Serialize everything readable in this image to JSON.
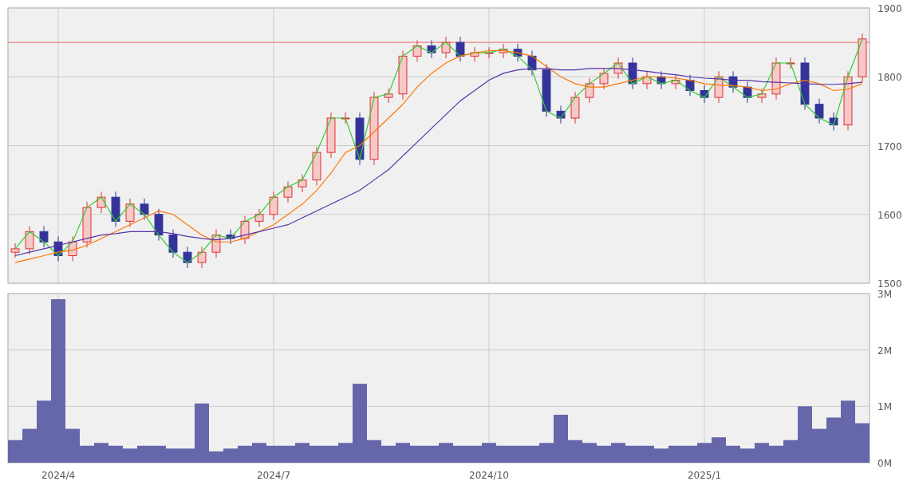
{
  "price_chart": {
    "chart_data": {
      "type": "candlestick",
      "ohlc": [
        [
          1545,
          1558,
          1537,
          1550
        ],
        [
          1550,
          1583,
          1542,
          1575
        ],
        [
          1575,
          1583,
          1552,
          1560
        ],
        [
          1560,
          1568,
          1532,
          1540
        ],
        [
          1540,
          1568,
          1532,
          1560
        ],
        [
          1560,
          1618,
          1552,
          1610
        ],
        [
          1610,
          1633,
          1602,
          1625
        ],
        [
          1625,
          1633,
          1582,
          1590
        ],
        [
          1590,
          1623,
          1582,
          1615
        ],
        [
          1615,
          1623,
          1592,
          1600
        ],
        [
          1600,
          1608,
          1562,
          1570
        ],
        [
          1570,
          1578,
          1537,
          1545
        ],
        [
          1545,
          1553,
          1522,
          1530
        ],
        [
          1530,
          1553,
          1522,
          1545
        ],
        [
          1545,
          1578,
          1537,
          1570
        ],
        [
          1570,
          1578,
          1557,
          1565
        ],
        [
          1565,
          1598,
          1557,
          1590
        ],
        [
          1590,
          1608,
          1582,
          1600
        ],
        [
          1600,
          1633,
          1592,
          1625
        ],
        [
          1625,
          1648,
          1617,
          1640
        ],
        [
          1640,
          1658,
          1632,
          1650
        ],
        [
          1650,
          1698,
          1642,
          1690
        ],
        [
          1690,
          1748,
          1682,
          1740
        ],
        [
          1740,
          1748,
          1732,
          1740
        ],
        [
          1740,
          1748,
          1672,
          1680
        ],
        [
          1680,
          1778,
          1672,
          1770
        ],
        [
          1770,
          1783,
          1762,
          1775
        ],
        [
          1775,
          1838,
          1767,
          1830
        ],
        [
          1830,
          1853,
          1822,
          1845
        ],
        [
          1845,
          1853,
          1827,
          1835
        ],
        [
          1835,
          1858,
          1827,
          1850
        ],
        [
          1850,
          1858,
          1822,
          1830
        ],
        [
          1830,
          1843,
          1822,
          1835
        ],
        [
          1835,
          1843,
          1827,
          1835
        ],
        [
          1835,
          1848,
          1827,
          1840
        ],
        [
          1840,
          1848,
          1822,
          1830
        ],
        [
          1830,
          1838,
          1802,
          1810
        ],
        [
          1810,
          1818,
          1742,
          1750
        ],
        [
          1750,
          1758,
          1732,
          1740
        ],
        [
          1740,
          1778,
          1732,
          1770
        ],
        [
          1770,
          1798,
          1762,
          1790
        ],
        [
          1790,
          1813,
          1782,
          1805
        ],
        [
          1805,
          1828,
          1797,
          1820
        ],
        [
          1820,
          1828,
          1782,
          1790
        ],
        [
          1790,
          1808,
          1782,
          1800
        ],
        [
          1800,
          1808,
          1782,
          1790
        ],
        [
          1790,
          1803,
          1782,
          1795
        ],
        [
          1795,
          1803,
          1772,
          1780
        ],
        [
          1780,
          1788,
          1762,
          1770
        ],
        [
          1770,
          1808,
          1762,
          1800
        ],
        [
          1800,
          1808,
          1777,
          1785
        ],
        [
          1785,
          1793,
          1762,
          1770
        ],
        [
          1770,
          1783,
          1762,
          1775
        ],
        [
          1775,
          1828,
          1767,
          1820
        ],
        [
          1820,
          1828,
          1812,
          1820
        ],
        [
          1820,
          1828,
          1752,
          1760
        ],
        [
          1760,
          1768,
          1732,
          1740
        ],
        [
          1740,
          1748,
          1722,
          1730
        ],
        [
          1730,
          1808,
          1722,
          1800
        ],
        [
          1800,
          1863,
          1792,
          1855
        ]
      ],
      "grid": true,
      "ylim": [
        1500,
        1900
      ],
      "categories": [
        null,
        null,
        null,
        null,
        null,
        null,
        null,
        null,
        null,
        null,
        null,
        null,
        null,
        null,
        null,
        null,
        null,
        null,
        null,
        null,
        null,
        null,
        null,
        null,
        null,
        null,
        null,
        null,
        null,
        null,
        null,
        null,
        null,
        null,
        null,
        null,
        null,
        null,
        null,
        null,
        null,
        null,
        null,
        null,
        null,
        null,
        null,
        null,
        null,
        null,
        null,
        null,
        null,
        null,
        null,
        null,
        null,
        null,
        null,
        null
      ],
      "yticks": [
        {
          "value": 1500,
          "label": "1500"
        },
        {
          "value": 1600,
          "label": "1600"
        },
        {
          "value": 1700,
          "label": "1700"
        },
        {
          "value": 1800,
          "label": "1800"
        },
        {
          "value": 1900,
          "label": "1900"
        }
      ],
      "series": [
        {
          "type": "line",
          "color": "#33cc33",
          "values": [
            1550,
            1575,
            1560,
            1540,
            1560,
            1610,
            1625,
            1590,
            1615,
            1600,
            1570,
            1545,
            1530,
            1545,
            1570,
            1565,
            1590,
            1600,
            1625,
            1640,
            1650,
            1690,
            1740,
            1740,
            1680,
            1770,
            1775,
            1830,
            1845,
            1835,
            1850,
            1830,
            1835,
            1835,
            1840,
            1830,
            1810,
            1750,
            1740,
            1770,
            1790,
            1805,
            1820,
            1790,
            1800,
            1790,
            1795,
            1780,
            1770,
            1800,
            1785,
            1770,
            1775,
            1820,
            1820,
            1760,
            1740,
            1730,
            1800,
            1855
          ]
        },
        {
          "type": "line",
          "color": "#ff7700",
          "values": [
            1530,
            1535,
            1540,
            1545,
            1548,
            1555,
            1565,
            1575,
            1585,
            1595,
            1605,
            1600,
            1585,
            1570,
            1560,
            1560,
            1565,
            1575,
            1585,
            1600,
            1615,
            1635,
            1660,
            1690,
            1700,
            1720,
            1740,
            1760,
            1785,
            1805,
            1820,
            1830,
            1835,
            1838,
            1838,
            1835,
            1830,
            1815,
            1800,
            1790,
            1785,
            1785,
            1790,
            1795,
            1800,
            1800,
            1798,
            1795,
            1790,
            1788,
            1787,
            1785,
            1780,
            1782,
            1790,
            1795,
            1790,
            1780,
            1782,
            1790
          ]
        },
        {
          "type": "line",
          "color": "#5533aa",
          "values": [
            1540,
            1545,
            1550,
            1555,
            1560,
            1565,
            1570,
            1572,
            1575,
            1575,
            1575,
            1572,
            1568,
            1565,
            1563,
            1565,
            1570,
            1575,
            1580,
            1585,
            1595,
            1605,
            1615,
            1625,
            1635,
            1650,
            1665,
            1685,
            1705,
            1725,
            1745,
            1765,
            1780,
            1795,
            1805,
            1810,
            1812,
            1812,
            1810,
            1810,
            1812,
            1812,
            1812,
            1810,
            1808,
            1805,
            1803,
            1800,
            1798,
            1797,
            1795,
            1795,
            1793,
            1792,
            1791,
            1790,
            1789,
            1789,
            1790,
            1792
          ]
        }
      ],
      "ref_lines": [
        {
          "axis": "y",
          "value": 1850,
          "color": "#ee6666"
        }
      ]
    }
  },
  "volume_chart": {
    "chart_data": {
      "type": "bar",
      "grid": true,
      "ylim": [
        0,
        3
      ],
      "yticks": [
        {
          "value": 0,
          "label": "0M"
        },
        {
          "value": 1,
          "label": "1M"
        },
        {
          "value": 2,
          "label": "2M"
        },
        {
          "value": 3,
          "label": "3M"
        }
      ],
      "categories": [
        null,
        null,
        null,
        "2024/4",
        null,
        null,
        null,
        null,
        null,
        null,
        null,
        null,
        null,
        null,
        null,
        null,
        null,
        null,
        "2024/7",
        null,
        null,
        null,
        null,
        null,
        null,
        null,
        null,
        null,
        null,
        null,
        null,
        null,
        null,
        "2024/10",
        null,
        null,
        null,
        null,
        null,
        null,
        null,
        null,
        null,
        null,
        null,
        null,
        null,
        null,
        "2025/1",
        null,
        null,
        null,
        null,
        null,
        null,
        null,
        null,
        null,
        null,
        null
      ],
      "series": [
        {
          "color": "#6666aa",
          "values": [
            0.4,
            0.6,
            1.1,
            2.9,
            0.6,
            0.3,
            0.35,
            0.3,
            0.25,
            0.3,
            0.3,
            0.25,
            0.25,
            1.05,
            0.2,
            0.25,
            0.3,
            0.35,
            0.3,
            0.3,
            0.35,
            0.3,
            0.3,
            0.35,
            1.4,
            0.4,
            0.3,
            0.35,
            0.3,
            0.3,
            0.35,
            0.3,
            0.3,
            0.35,
            0.3,
            0.3,
            0.3,
            0.35,
            0.85,
            0.4,
            0.35,
            0.3,
            0.35,
            0.3,
            0.3,
            0.25,
            0.3,
            0.3,
            0.35,
            0.45,
            0.3,
            0.25,
            0.35,
            0.3,
            0.4,
            1.0,
            0.6,
            0.8,
            1.1,
            0.7
          ]
        }
      ]
    }
  }
}
